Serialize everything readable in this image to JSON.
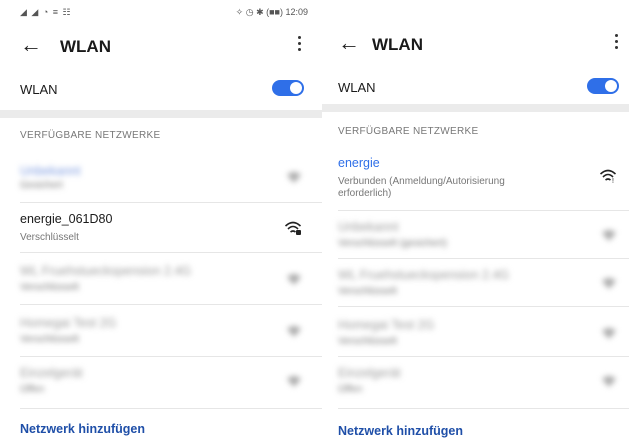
{
  "left": {
    "status_left": "◢ ◢ ◔ ≡ ☷",
    "status_right": "✧ ◷ ✱ (■■) 12:09",
    "title": "WLAN",
    "wlan_label": "WLAN",
    "section": "VERFÜGBARE NETZWERKE",
    "networks": [
      {
        "name": "Unbekannt",
        "sub": "Gesichert",
        "blurred": true,
        "highlight": true
      },
      {
        "name": "energie_061D80",
        "sub": "Verschlüsselt",
        "blurred": false
      },
      {
        "name": "WL Fruehstueckspension 2.4G",
        "sub": "Verschlüsselt",
        "blurred": true
      },
      {
        "name": "Homegai Test 2G",
        "sub": "Verschlüsselt",
        "blurred": true
      },
      {
        "name": "Einzelgerät",
        "sub": "Offen",
        "blurred": true
      }
    ],
    "add_network": "Netzwerk hinzufügen"
  },
  "right": {
    "title": "WLAN",
    "wlan_label": "WLAN",
    "section": "VERFÜGBARE NETZWERKE",
    "networks": [
      {
        "name": "energie",
        "sub": "Verbunden (Anmeldung/Autorisierung erforderlich)",
        "blurred": false,
        "highlight": true
      },
      {
        "name": "Unbekannt",
        "sub": "Verschlüsselt (gesichert)",
        "blurred": true
      },
      {
        "name": "WL Fruehstueckspension 2.4G",
        "sub": "Verschlüsselt",
        "blurred": true
      },
      {
        "name": "Homegai Test 2G",
        "sub": "Verschlüsselt",
        "blurred": true
      },
      {
        "name": "Einzelgerät",
        "sub": "Offen",
        "blurred": true
      }
    ],
    "add_network": "Netzwerk hinzufügen"
  },
  "colors": {
    "accent": "#2f6fe8",
    "link": "#1f4fa8"
  }
}
